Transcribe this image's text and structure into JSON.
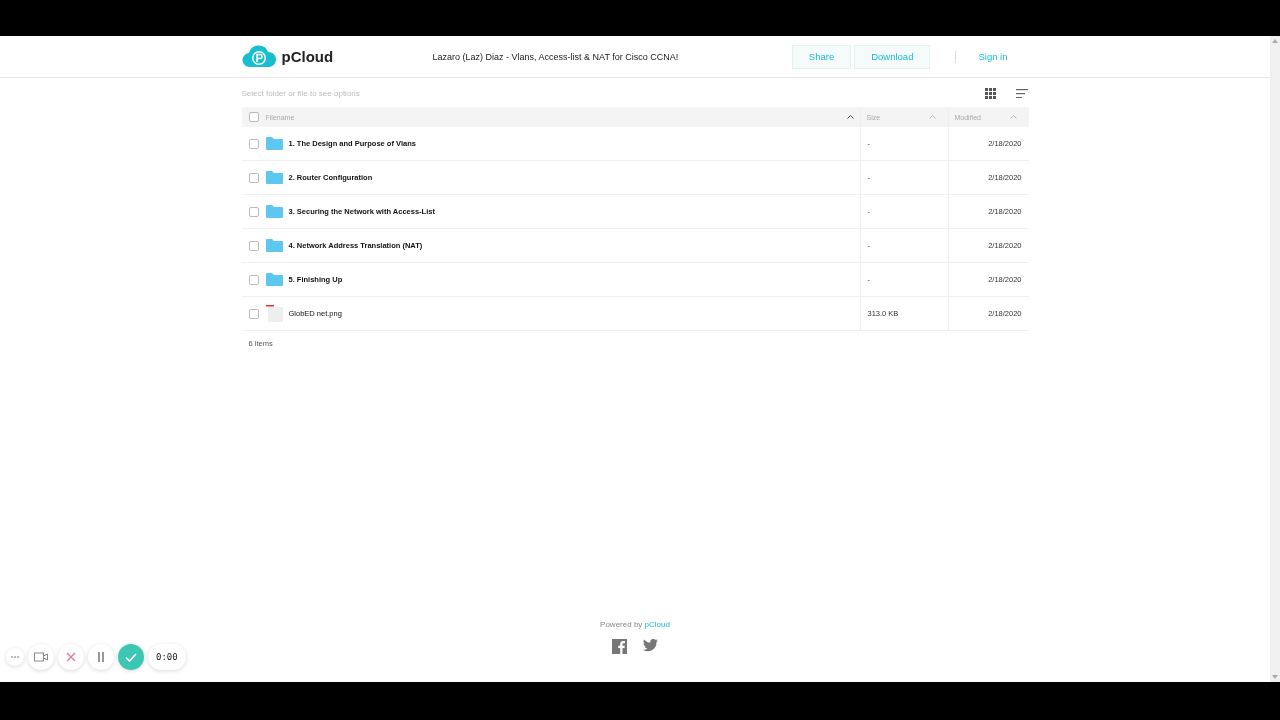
{
  "header": {
    "logo": "pCloud",
    "title": "Lazaro (Laz) Diaz - Vlans, Access-list & NAT for Cisco CCNA!",
    "buttons": [
      "Share",
      "Download"
    ],
    "sign_in": "Sign in"
  },
  "toolbar": {
    "hint": "Select folder or file to see options"
  },
  "table": {
    "select_all": false,
    "columns": [
      "Filename",
      "Size",
      "Modified"
    ],
    "rows": [
      {
        "kind": "folder",
        "name": "1. The Design and Purpose of Vlans",
        "size": "-",
        "modified": "2/18/2020",
        "checked": false
      },
      {
        "kind": "folder",
        "name": "2. Router Configuration",
        "size": "-",
        "modified": "2/18/2020",
        "checked": false
      },
      {
        "kind": "folder",
        "name": "3. Securing the Network with Access-List",
        "size": "-",
        "modified": "2/18/2020",
        "checked": false
      },
      {
        "kind": "folder",
        "name": "4. Network Address Translation (NAT)",
        "size": "-",
        "modified": "2/18/2020",
        "checked": false
      },
      {
        "kind": "folder",
        "name": "5. Finishing Up",
        "size": "-",
        "modified": "2/18/2020",
        "checked": false
      },
      {
        "kind": "file",
        "name": "GlobED net.png",
        "size": "313.0 KB",
        "modified": "2/18/2020",
        "checked": false
      }
    ],
    "count": "6 items"
  },
  "footer": {
    "powered_by": "Powered by",
    "brand": "pCloud"
  },
  "recorder": {
    "timer": "0:00"
  }
}
